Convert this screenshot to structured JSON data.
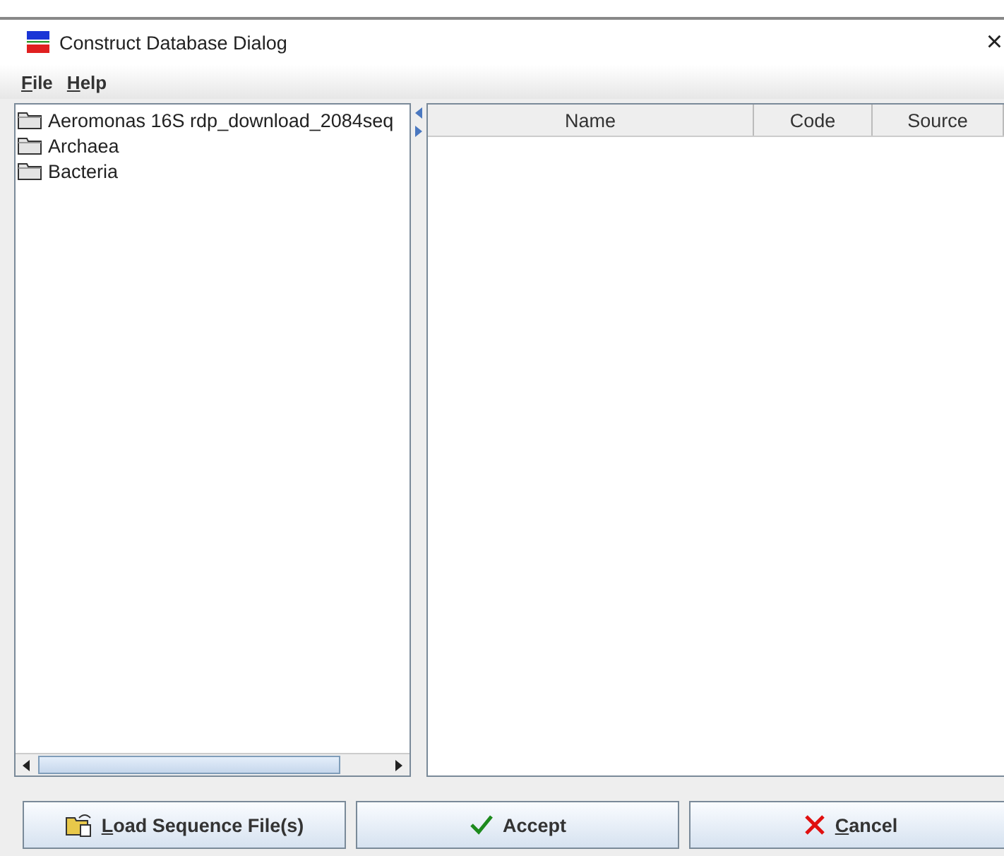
{
  "window": {
    "title": "Construct Database Dialog",
    "close": "×"
  },
  "menu": [
    {
      "mnemonic": "F",
      "text": "ile"
    },
    {
      "mnemonic": "H",
      "text": "elp"
    }
  ],
  "tree": {
    "items": [
      {
        "label": "Aeromonas 16S rdp_download_2084seq"
      },
      {
        "label": "Archaea"
      },
      {
        "label": "Bacteria"
      }
    ]
  },
  "table": {
    "columns": [
      "Name",
      "Code",
      "Source"
    ]
  },
  "buttons": [
    {
      "kind": "load",
      "mnemonic": "L",
      "text": "oad Sequence File(s)"
    },
    {
      "kind": "accept",
      "text": "Accept"
    },
    {
      "kind": "cancel",
      "mnemonic": "C",
      "text": "ancel"
    }
  ]
}
